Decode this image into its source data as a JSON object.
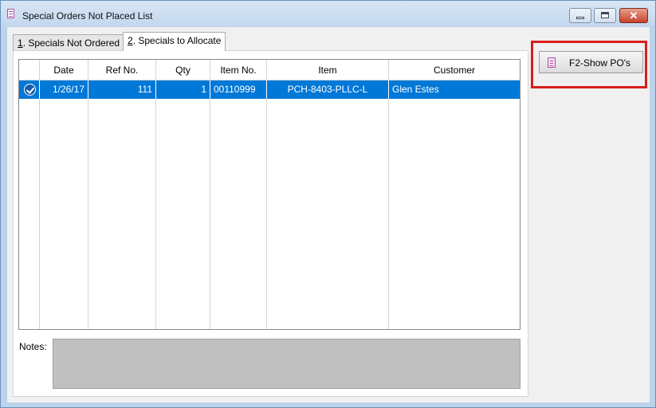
{
  "window": {
    "title": "Special Orders Not Placed List",
    "close_glyph": "✕"
  },
  "tabs": [
    {
      "key": "1",
      "label": ". Specials Not Ordered",
      "active": false
    },
    {
      "key": "2",
      "label": ". Specials to Allocate",
      "active": true
    }
  ],
  "grid": {
    "columns": [
      "Date",
      "Ref No.",
      "Qty",
      "Item No.",
      "Item",
      "Customer"
    ],
    "rows": [
      {
        "selected": true,
        "date": "1/26/17",
        "ref_no": "111",
        "qty": "1",
        "item_no": "00110999",
        "item": "PCH-8403-PLLC-L",
        "customer": "Glen Estes"
      }
    ]
  },
  "notes": {
    "label": "Notes:",
    "value": ""
  },
  "actions": {
    "show_pos_label": "F2-Show PO's",
    "icon": "document-icon"
  },
  "colors": {
    "selection": "#0078d7",
    "highlight": "#d81e1e",
    "notes_bg": "#c0c0c0"
  }
}
